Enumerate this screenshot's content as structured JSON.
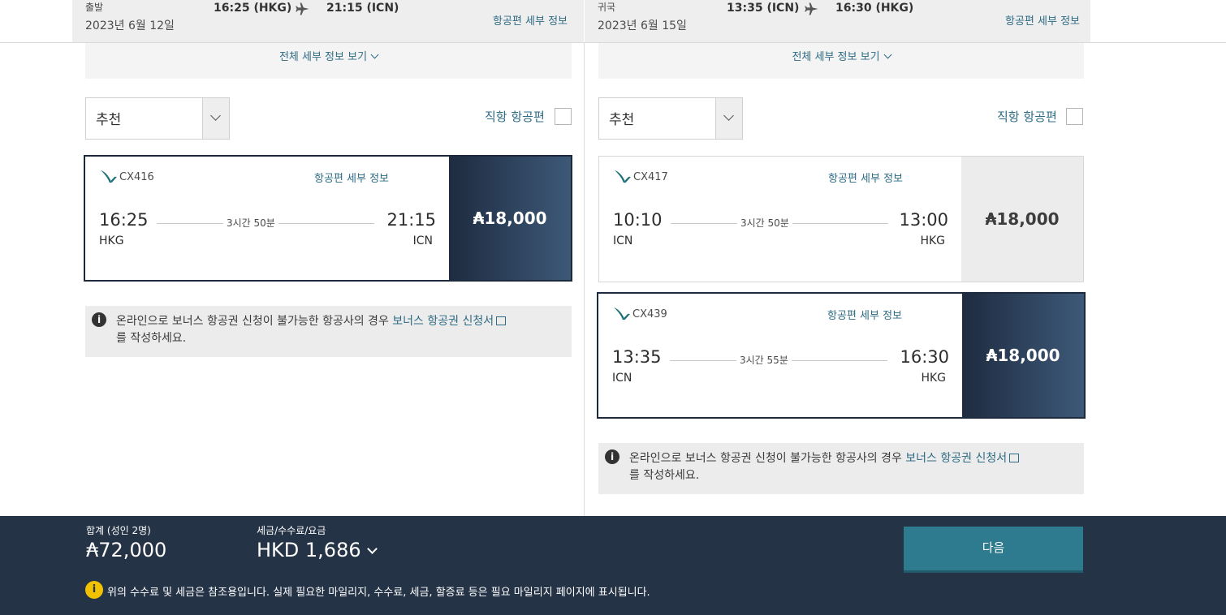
{
  "outbound": {
    "label": "출발",
    "date": "2023년 6월 12일",
    "dep": "16:25 (HKG)",
    "arr": "21:15 (ICN)",
    "details_link": "항공편 세부 정보",
    "expand_label": "전체 세부 정보 보기",
    "sort_value": "추천",
    "nonstop_label": "직항 항공편",
    "flights": [
      {
        "number": "CX416",
        "details_link": "항공편 세부 정보",
        "dep_time": "16:25",
        "dep_code": "HKG",
        "arr_time": "21:15",
        "arr_code": "ICN",
        "duration": "3시간 50분",
        "price": "₳18,000",
        "selected": true
      }
    ],
    "notice": {
      "text": "온라인으로 보너스 항공권 신청이 불가능한 항공사의 경우 ",
      "link": "보너스 항공권 신청서",
      "tail": "를 작성하세요."
    }
  },
  "inbound": {
    "label": "귀국",
    "date": "2023년 6월 15일",
    "dep": "13:35 (ICN)",
    "arr": "16:30 (HKG)",
    "details_link": "항공편 세부 정보",
    "expand_label": "전체 세부 정보 보기",
    "sort_value": "추천",
    "nonstop_label": "직항 항공편",
    "flights": [
      {
        "number": "CX417",
        "details_link": "항공편 세부 정보",
        "dep_time": "10:10",
        "dep_code": "ICN",
        "arr_time": "13:00",
        "arr_code": "HKG",
        "duration": "3시간 50분",
        "price": "₳18,000",
        "selected": false
      },
      {
        "number": "CX439",
        "details_link": "항공편 세부 정보",
        "dep_time": "13:35",
        "dep_code": "ICN",
        "arr_time": "16:30",
        "arr_code": "HKG",
        "duration": "3시간 55분",
        "price": "₳18,000",
        "selected": true
      }
    ],
    "notice": {
      "text": "온라인으로 보너스 항공권 신청이 불가능한 항공사의 경우 ",
      "link": "보너스 항공권 신청서",
      "tail": "를 작성하세요."
    }
  },
  "footer": {
    "total_label": "합계 (성인 2명)",
    "total_value": "₳72,000",
    "tax_label": "세금/수수료/요금",
    "tax_value": "HKD 1,686",
    "next_label": "다음",
    "warning_icon": "i",
    "warning": "위의 수수료 및 세금은 참조용입니다. 실제 필요한 마일리지, 수수료, 세금, 할증료 등은 필요 마일리지 페이지에 표시됩니다."
  },
  "colors": {
    "navy": "#253347",
    "teal": "#2e6b84",
    "button": "#2e7a8f",
    "warning": "#f2c200"
  },
  "icons": {
    "plane": "plane-icon",
    "airline_logo": "cathay-logo-icon",
    "info": "info-icon",
    "chevron": "chevron-down-icon",
    "external": "external-link-icon"
  }
}
